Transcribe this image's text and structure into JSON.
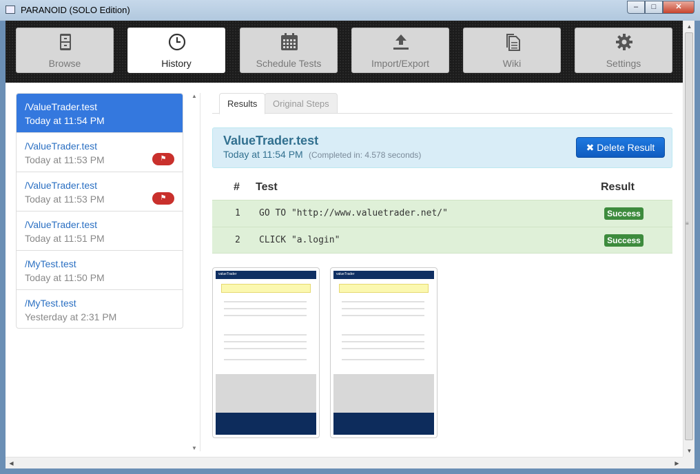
{
  "window": {
    "title": "PARANOID (SOLO Edition)",
    "min": "–",
    "max": "□",
    "close": "✕"
  },
  "toolbar": {
    "items": [
      {
        "label": "Browse",
        "icon": "filing-cabinet-icon"
      },
      {
        "label": "History",
        "icon": "clock-icon",
        "active": true
      },
      {
        "label": "Schedule Tests",
        "icon": "calendar-icon"
      },
      {
        "label": "Import/Export",
        "icon": "upload-icon"
      },
      {
        "label": "Wiki",
        "icon": "documents-icon"
      },
      {
        "label": "Settings",
        "icon": "gear-icon"
      }
    ]
  },
  "history": {
    "items": [
      {
        "name": "/ValueTrader.test",
        "time": "Today at 11:54 PM",
        "selected": true,
        "flag": false
      },
      {
        "name": "/ValueTrader.test",
        "time": "Today at 11:53 PM",
        "flag": true
      },
      {
        "name": "/ValueTrader.test",
        "time": "Today at 11:53 PM",
        "flag": true
      },
      {
        "name": "/ValueTrader.test",
        "time": "Today at 11:51 PM",
        "flag": false
      },
      {
        "name": "/MyTest.test",
        "time": "Today at 11:50 PM",
        "flag": false
      },
      {
        "name": "/MyTest.test",
        "time": "Yesterday at 2:31 PM",
        "flag": false
      }
    ]
  },
  "tabs": {
    "results": "Results",
    "original_steps": "Original Steps"
  },
  "result": {
    "name": "ValueTrader.test",
    "time": "Today at 11:54 PM",
    "completed": "(Completed in: 4.578 seconds)",
    "delete_label": "Delete Result",
    "delete_icon": "✖"
  },
  "table": {
    "headers": {
      "num": "#",
      "test": "Test",
      "result": "Result"
    },
    "rows": [
      {
        "num": "1",
        "cmd": "GO TO \"http://www.valuetrader.net/\"",
        "status": "Success"
      },
      {
        "num": "2",
        "cmd": "CLICK \"a.login\"",
        "status": "Success"
      }
    ]
  },
  "screenshots": {
    "brand": "valueTrader"
  },
  "colors": {
    "accent": "#3478de",
    "success": "#3d8b3d",
    "danger": "#c9302c",
    "info_bg": "#d9edf7"
  }
}
